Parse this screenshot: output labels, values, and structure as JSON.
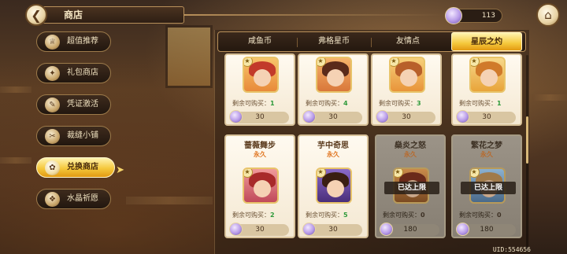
{
  "header": {
    "back_icon": "back-arrow-icon",
    "title": "商店",
    "currency": {
      "icon": "star-gem-icon",
      "amount": "113"
    },
    "home_icon": "home-icon"
  },
  "sidebar": {
    "items": [
      {
        "label": "超值推荐",
        "icon": "crown-icon",
        "active": false
      },
      {
        "label": "礼包商店",
        "icon": "gift-icon",
        "active": false
      },
      {
        "label": "凭证激活",
        "icon": "ticket-icon",
        "active": false
      },
      {
        "label": "裁缝小铺",
        "icon": "outfit-icon",
        "active": false
      },
      {
        "label": "兑换商店",
        "icon": "exchange-icon",
        "active": true
      },
      {
        "label": "水晶祈愿",
        "icon": "crystal-icon",
        "active": false
      }
    ]
  },
  "tabs": [
    {
      "label": "咸鱼币",
      "active": false
    },
    {
      "label": "弗格星币",
      "active": false
    },
    {
      "label": "友情点",
      "active": false
    },
    {
      "label": "星辰之灼",
      "active": true
    }
  ],
  "items_row1": [
    {
      "remain_label": "剩余可购买：",
      "remain": "1",
      "price": "30"
    },
    {
      "remain_label": "剩余可购买：",
      "remain": "4",
      "price": "30"
    },
    {
      "remain_label": "剩余可购买：",
      "remain": "3",
      "price": "30"
    },
    {
      "remain_label": "剩余可购买：",
      "remain": "1",
      "price": "30"
    }
  ],
  "items_row2": [
    {
      "name": "蔷薇舞步",
      "duration": "永久",
      "remain_label": "剩余可购买：",
      "remain": "2",
      "price": "30",
      "limit": ""
    },
    {
      "name": "芋中奇思",
      "duration": "永久",
      "remain_label": "剩余可购买：",
      "remain": "5",
      "price": "30",
      "limit": ""
    },
    {
      "name": "燊炎之怒",
      "duration": "永久",
      "remain_label": "剩余可购买：",
      "remain": "0",
      "price": "180",
      "limit": "已达上限"
    },
    {
      "name": "繁花之梦",
      "duration": "永久",
      "remain_label": "剩余可购买：",
      "remain": "0",
      "price": "180",
      "limit": "已达上限"
    }
  ],
  "footer": {
    "uid": "UID:554656"
  },
  "colors": {
    "accent": "#f5c83c",
    "card_bg": "#fffaf0",
    "remain_num": "#2e9a3a",
    "duration": "#e0741e"
  }
}
